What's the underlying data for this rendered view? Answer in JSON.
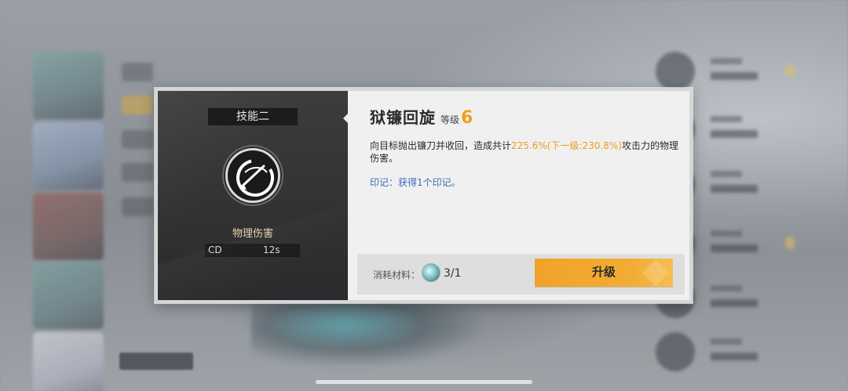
{
  "skill_panel": {
    "slot_label": "技能二",
    "damage_type": "物理伤害",
    "cd_label": "CD",
    "cd_value": "12s",
    "icon": "scythe-spin-icon"
  },
  "skill_info": {
    "name": "狱镰回旋",
    "level_label": "等级",
    "level_value": "6",
    "desc_prefix": "向目标抛出镰刀并收回，造成共计",
    "desc_highlight": "225.6%(下一级:230.8%)",
    "desc_suffix": "攻击力的物理伤害。",
    "mark_text": "印记：获得1个印记。"
  },
  "upgrade": {
    "material_label": "消耗材料：",
    "material_icon": "skill-core-icon",
    "material_count": "3/1",
    "button_label": "升级"
  },
  "colors": {
    "accent_orange": "#f0a020",
    "mark_blue": "#3a6ab8",
    "damage_type_gold": "#e7d9a8"
  }
}
